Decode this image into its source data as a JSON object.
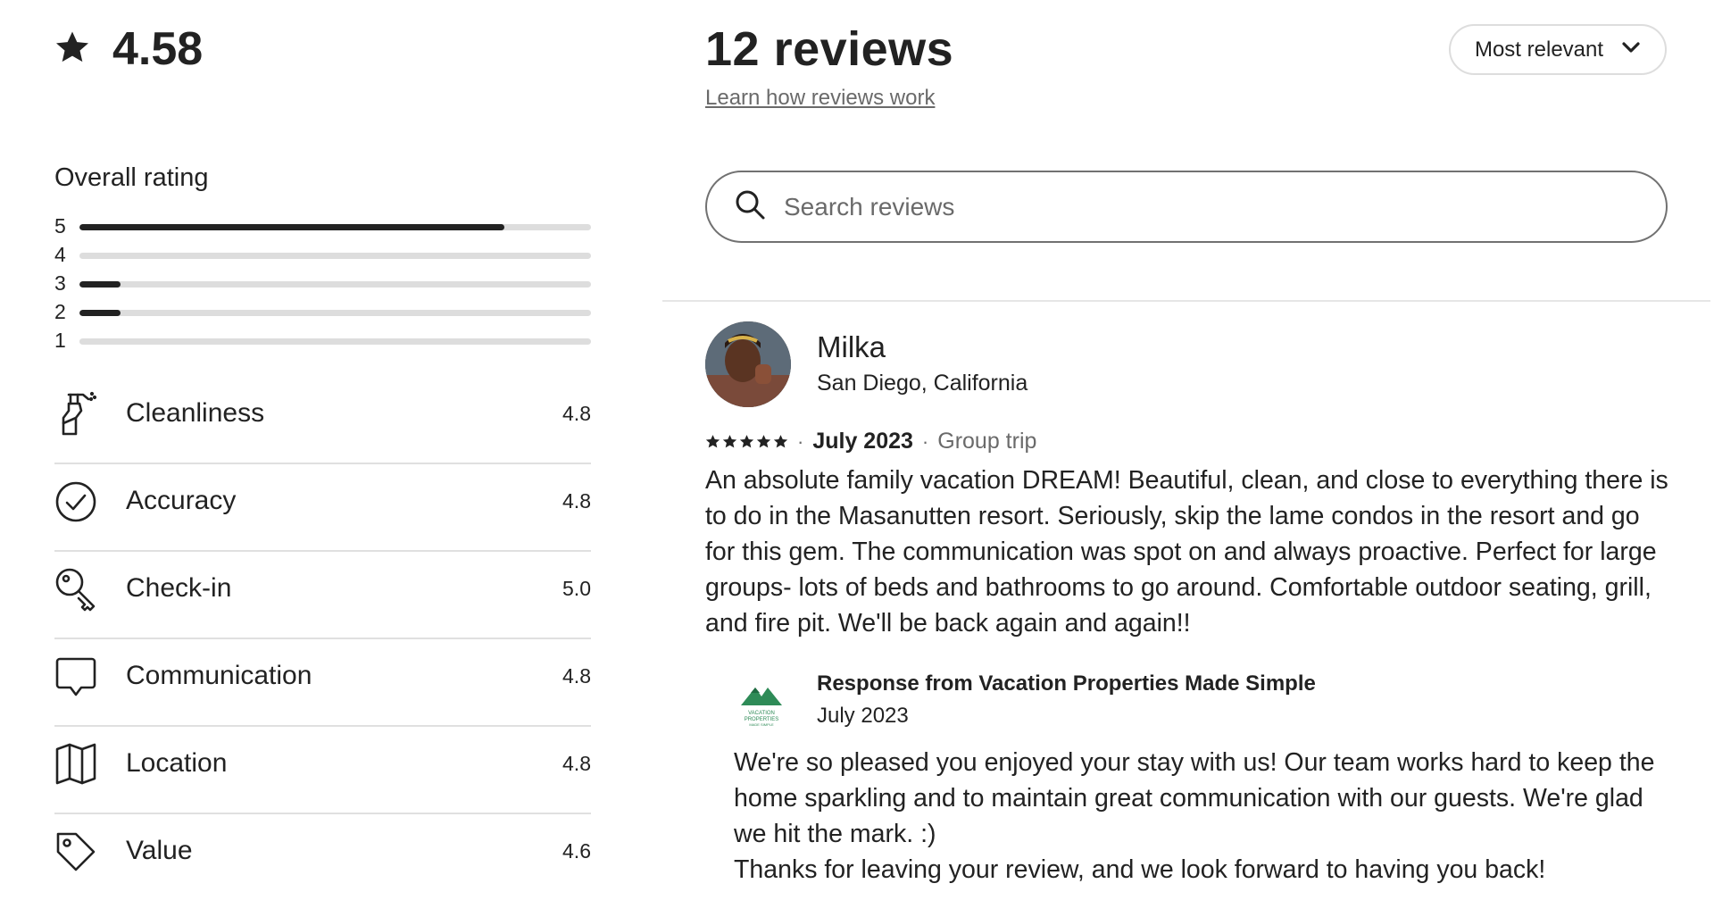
{
  "summary": {
    "rating": "4.58",
    "overall_title": "Overall rating",
    "distribution": [
      {
        "stars": "5",
        "fraction": 0.83
      },
      {
        "stars": "4",
        "fraction": 0.0
      },
      {
        "stars": "3",
        "fraction": 0.08
      },
      {
        "stars": "2",
        "fraction": 0.08
      },
      {
        "stars": "1",
        "fraction": 0.0
      }
    ],
    "categories": [
      {
        "label": "Cleanliness",
        "score": "4.8",
        "icon": "spray-bottle-icon"
      },
      {
        "label": "Accuracy",
        "score": "4.8",
        "icon": "check-circle-icon"
      },
      {
        "label": "Check-in",
        "score": "5.0",
        "icon": "key-icon"
      },
      {
        "label": "Communication",
        "score": "4.8",
        "icon": "chat-bubble-icon"
      },
      {
        "label": "Location",
        "score": "4.8",
        "icon": "map-icon"
      },
      {
        "label": "Value",
        "score": "4.6",
        "icon": "price-tag-icon"
      }
    ]
  },
  "header": {
    "count_title": "12 reviews",
    "learn_link": "Learn how reviews work",
    "sort_label": "Most relevant"
  },
  "search": {
    "placeholder": "Search reviews",
    "value": ""
  },
  "reviews": [
    {
      "name": "Milka",
      "location": "San Diego, California",
      "stars": 5,
      "date": "July 2023",
      "trip_type": "Group trip",
      "text": "An absolute family vacation DREAM! Beautiful, clean, and close to everything there is to do in the Masanutten resort. Seriously, skip the lame condos in the resort and go for this gem. The communication was spot on and always proactive. Perfect for large groups- lots of beds and bathrooms to go around. Comfortable outdoor seating, grill, and fire pit. We'll be back again and again!!",
      "response": {
        "title": "Response from Vacation Properties Made Simple",
        "date": "July 2023",
        "text_line1": "We're so pleased you enjoyed your stay with us! Our team works hard to keep the home sparkling and to maintain great communication with our guests. We're glad we hit the mark. :)",
        "text_line2": "Thanks for leaving your review, and we look forward to having you back!",
        "logo_text": [
          "VACATION",
          "PROPERTIES",
          "MADE SIMPLE"
        ]
      }
    }
  ],
  "colors": {
    "text": "#222222",
    "muted": "#6a6a6a",
    "bar_track": "#dddddd",
    "divider": "#e6e6e6",
    "logo_green": "#2e8b57"
  }
}
